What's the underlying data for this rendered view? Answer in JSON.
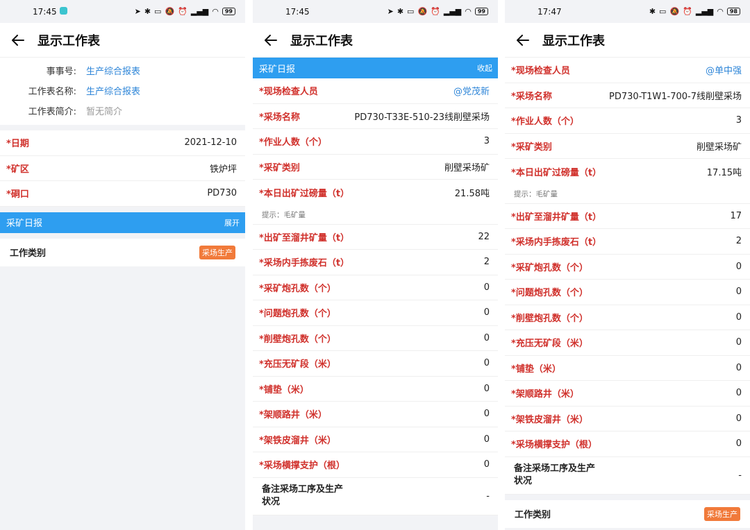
{
  "panel1": {
    "status_time": "17:45",
    "battery": "99",
    "title": "显示工作表",
    "info": [
      {
        "key": "事事号:",
        "value": "生产综合报表",
        "style": "link"
      },
      {
        "key": "工作表名称:",
        "value": "生产综合报表",
        "style": "link"
      },
      {
        "key": "工作表简介:",
        "value": "暂无简介",
        "style": "gray"
      }
    ],
    "fields": [
      {
        "label": "日期",
        "value": "2021-12-10"
      },
      {
        "label": "矿区",
        "value": "铁炉坪"
      },
      {
        "label": "硐口",
        "value": "PD730"
      }
    ],
    "section": {
      "title": "采矿日报",
      "action": "展开"
    },
    "type_label": "工作类别",
    "type_tag": "采场生产"
  },
  "panel2": {
    "status_time": "17:45",
    "battery": "99",
    "title": "显示工作表",
    "section": {
      "title": "采矿日报",
      "action": "收起"
    },
    "inspector_label": "现场检查人员",
    "inspector_value": "@党茂新",
    "fields_top": [
      {
        "label": "采场名称",
        "value": "PD730-T33E-510-23线削壁采场"
      },
      {
        "label": "作业人数（个）",
        "value": "3"
      },
      {
        "label": "采矿类别",
        "value": "削壁采场矿"
      },
      {
        "label": "本日出矿过磅量（t）",
        "value": "21.58吨"
      }
    ],
    "hint": "提示：毛矿量",
    "fields_bottom": [
      {
        "label": "出矿至溜井矿量（t）",
        "value": "22"
      },
      {
        "label": "采场内手拣废石（t）",
        "value": "2"
      },
      {
        "label": "采矿炮孔数（个）",
        "value": "0"
      },
      {
        "label": "问题炮孔数（个）",
        "value": "0"
      },
      {
        "label": "削壁炮孔数（个）",
        "value": "0"
      },
      {
        "label": "充压无矿段（米）",
        "value": "0"
      },
      {
        "label": "铺垫（米）",
        "value": "0"
      },
      {
        "label": "架顺路井（米）",
        "value": "0"
      },
      {
        "label": "架铁皮溜井（米）",
        "value": "0"
      },
      {
        "label": "采场横撑支护（根）",
        "value": "0"
      }
    ],
    "remark_label": "备注采场工序及生产状况",
    "remark_value": "-"
  },
  "panel3": {
    "status_time": "17:47",
    "battery": "98",
    "title": "显示工作表",
    "inspector_label": "现场检查人员",
    "inspector_value": "@单中强",
    "fields_top": [
      {
        "label": "采场名称",
        "value": "PD730-T1W1-700-7线削壁采场"
      },
      {
        "label": "作业人数（个）",
        "value": "3"
      },
      {
        "label": "采矿类别",
        "value": "削壁采场矿"
      },
      {
        "label": "本日出矿过磅量（t）",
        "value": "17.15吨"
      }
    ],
    "hint": "提示：毛矿量",
    "fields_bottom": [
      {
        "label": "出矿至溜井矿量（t）",
        "value": "17"
      },
      {
        "label": "采场内手拣废石（t）",
        "value": "2"
      },
      {
        "label": "采矿炮孔数（个）",
        "value": "0"
      },
      {
        "label": "问题炮孔数（个）",
        "value": "0"
      },
      {
        "label": "削壁炮孔数（个）",
        "value": "0"
      },
      {
        "label": "充压无矿段（米）",
        "value": "0"
      },
      {
        "label": "铺垫（米）",
        "value": "0"
      },
      {
        "label": "架顺路井（米）",
        "value": "0"
      },
      {
        "label": "架铁皮溜井（米）",
        "value": "0"
      },
      {
        "label": "采场横撑支护（根）",
        "value": "0"
      }
    ],
    "remark_label": "备注采场工序及生产状况",
    "remark_value": "-",
    "type_label": "工作类别",
    "type_tag": "采场生产"
  },
  "colors": {
    "section_blue": "#2e9ef0",
    "required_red": "#d0302b",
    "link_blue": "#2f86d8",
    "tag_orange": "#f17a3a"
  },
  "icons": [
    "back-arrow-icon",
    "location-icon",
    "bluetooth-icon",
    "vibrate-icon",
    "mute-icon",
    "alarm-icon",
    "signal-icon",
    "wifi-icon",
    "battery-icon"
  ]
}
